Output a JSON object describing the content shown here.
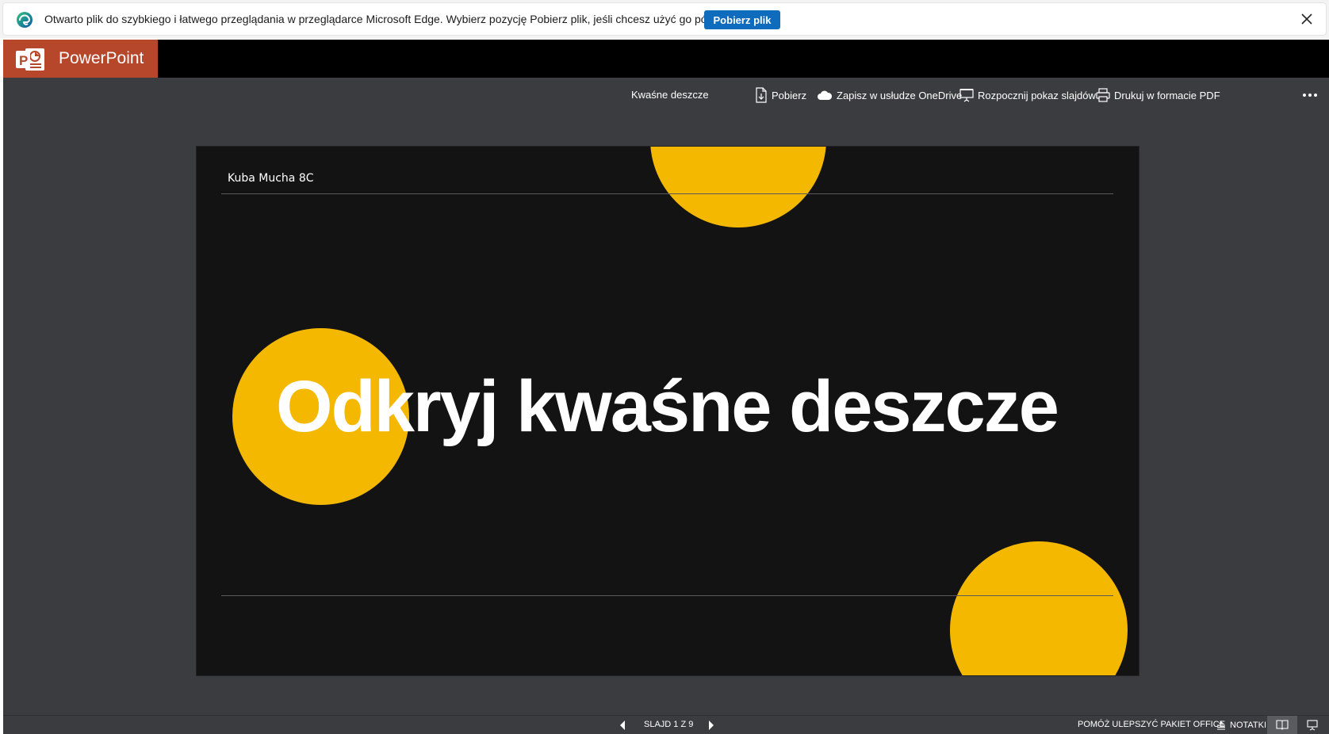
{
  "infobar": {
    "message": "Otwarto plik do szybkiego i łatwego przeglądania w przeglądarce Microsoft Edge. Wybierz pozycję Pobierz plik, jeśli chcesz użyć go później.",
    "download_button": "Pobierz plik",
    "close_icon": "close-icon",
    "browser_icon": "edge-icon"
  },
  "app": {
    "name": "PowerPoint",
    "brand_color": "#b7472a"
  },
  "commandbar": {
    "document_title": "Kwaśne deszcze",
    "download": "Pobierz",
    "save_onedrive": "Zapisz w usłudze OneDrive",
    "start_slideshow": "Rozpocznij pokaz slajdów",
    "print_pdf": "Drukuj w formacie PDF",
    "more_icon": "more-options-icon"
  },
  "slide": {
    "author": "Kuba Mucha 8C",
    "title": "Odkryj kwaśne deszcze",
    "background": "#131313",
    "accent": "#f4b800"
  },
  "statusbar": {
    "slide_counter": "SLAJD 1 Z 9",
    "help_improve": "POMÓŻ ULEPSZYĆ PAKIET OFFICE",
    "notes": "NOTATKI"
  }
}
